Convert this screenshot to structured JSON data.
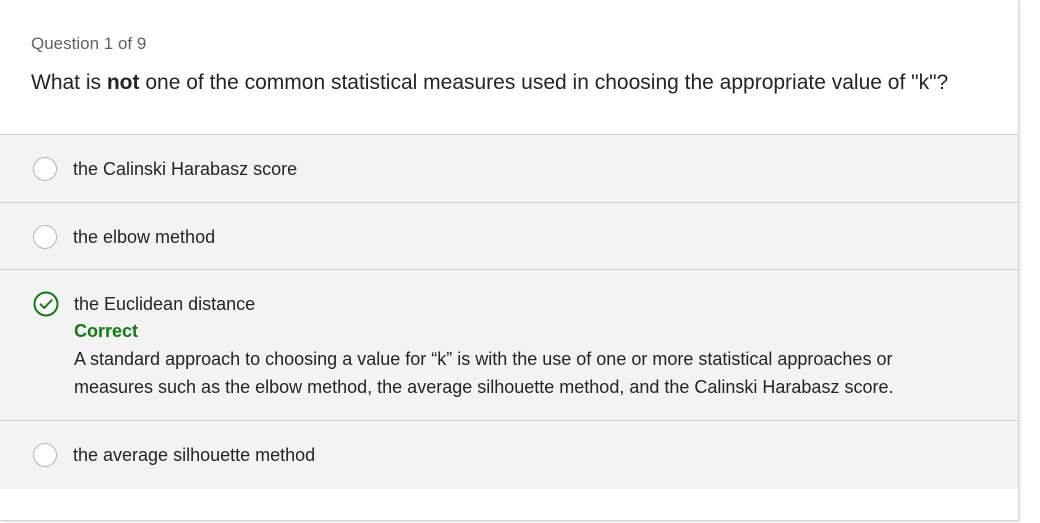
{
  "quiz": {
    "counter": "Question 1 of 9",
    "question_prefix": "What is ",
    "question_bold": "not",
    "question_suffix": " one of the common statistical measures used in choosing the appropriate value of \"k\"?",
    "options": [
      {
        "label": "the Calinski Harabasz score",
        "state": "unselected"
      },
      {
        "label": "the elbow method",
        "state": "unselected"
      },
      {
        "label": "the Euclidean distance",
        "state": "correct",
        "feedback_title": "Correct",
        "feedback_text": "A standard approach to choosing a value for “k” is with the use of one or more statistical approaches or measures such as the elbow method, the average silhouette method, and the Calinski Harabasz score."
      },
      {
        "label": "the average silhouette method",
        "state": "unselected"
      }
    ]
  },
  "colors": {
    "correct": "#107c10",
    "option_bg": "#f3f3f3",
    "divider": "#d1d1d1"
  },
  "icons": {
    "selected": "checkmark-circle-icon",
    "unselected": "radio-circle"
  }
}
